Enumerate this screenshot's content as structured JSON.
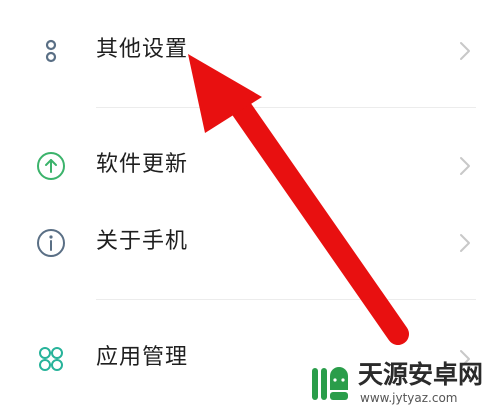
{
  "settings": {
    "items": [
      {
        "label": "其他设置",
        "icon": "more-dots-icon"
      },
      {
        "label": "软件更新",
        "icon": "arrow-up-circle-icon"
      },
      {
        "label": "关于手机",
        "icon": "info-circle-icon"
      },
      {
        "label": "应用管理",
        "icon": "apps-grid-icon"
      }
    ]
  },
  "watermark": {
    "title": "天源安卓网",
    "url": "www.jytyaz.com"
  },
  "colors": {
    "text": "#1f1f1f",
    "icon_gray": "#5a6f85",
    "icon_green": "#3bb36b",
    "icon_teal": "#27b39a",
    "chevron": "#c8c8c8",
    "divider": "#ececec",
    "annotation_red": "#e81010"
  }
}
